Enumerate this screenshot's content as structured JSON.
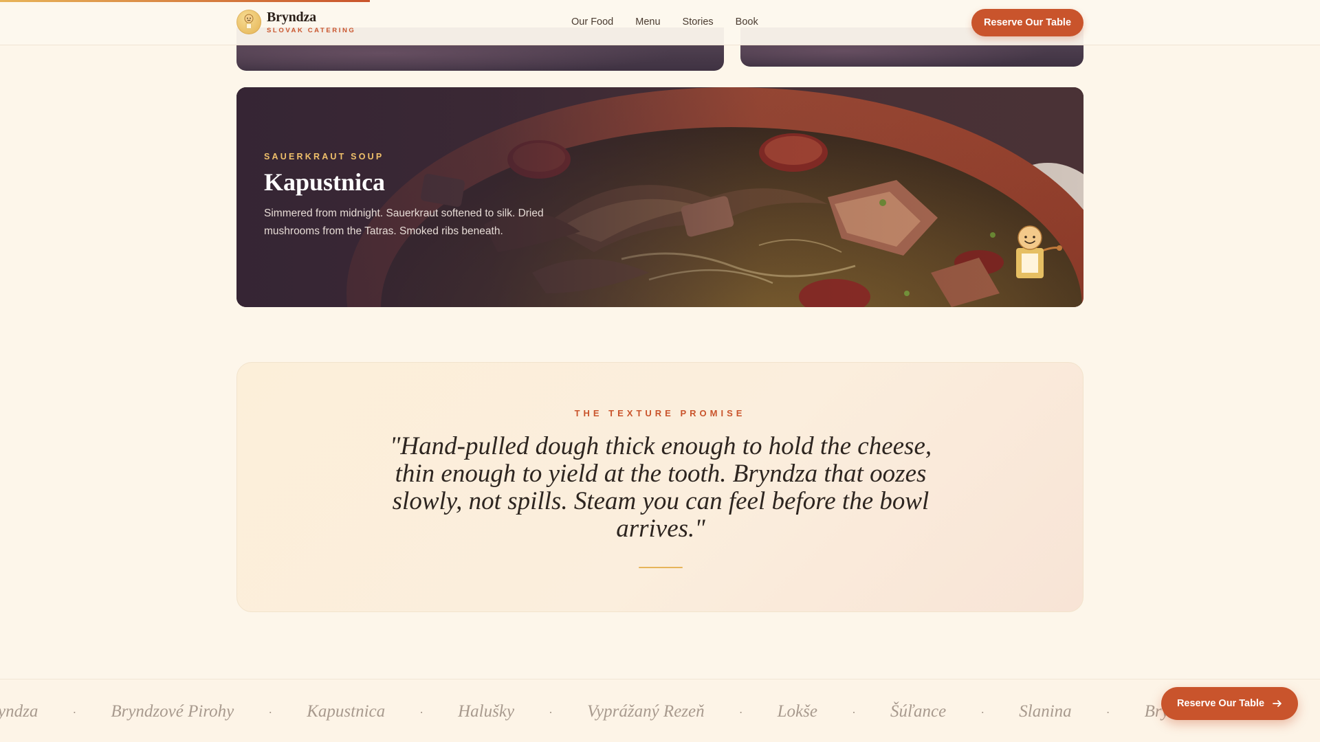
{
  "scroll_progress": 0.28,
  "colors": {
    "accent": "#c9542c",
    "gold": "#e6b45a",
    "cream": "#fdf6ea",
    "ink": "#2a1f18"
  },
  "header": {
    "brand_name": "Bryndza",
    "brand_tagline": "SLOVAK CATERING",
    "logo_icon": "chef-mascot-icon",
    "nav": [
      {
        "label": "Our Food"
      },
      {
        "label": "Menu"
      },
      {
        "label": "Stories"
      },
      {
        "label": "Book"
      }
    ],
    "cta_label": "Reserve Our Table"
  },
  "feature": {
    "eyebrow": "SAUERKRAUT SOUP",
    "title": "Kapustnica",
    "description": "Simmered from midnight. Sauerkraut softened to silk. Dried mushrooms from the Tatras. Smoked ribs beneath.",
    "image_icon": "soup-bowl-image",
    "mascot_icon": "chef-mascot-icon"
  },
  "promise": {
    "eyebrow": "THE TEXTURE PROMISE",
    "quote": "\"Hand-pulled dough thick enough to hold the cheese, thin enough to yield at the tooth. Bryndza that oozes slowly, not spills. Steam you can feel before the bowl arrives.\""
  },
  "marquee": {
    "items": [
      "Bryndza",
      "Bryndzové Pirohy",
      "Kapustnica",
      "Halušky",
      "Vyprážaný Rezeň",
      "Lokše",
      "Šúľance",
      "Slanina",
      "Bryndza"
    ],
    "separator": "·"
  },
  "floating_cta": {
    "label": "Reserve Our Table",
    "icon": "arrow-right-icon"
  }
}
